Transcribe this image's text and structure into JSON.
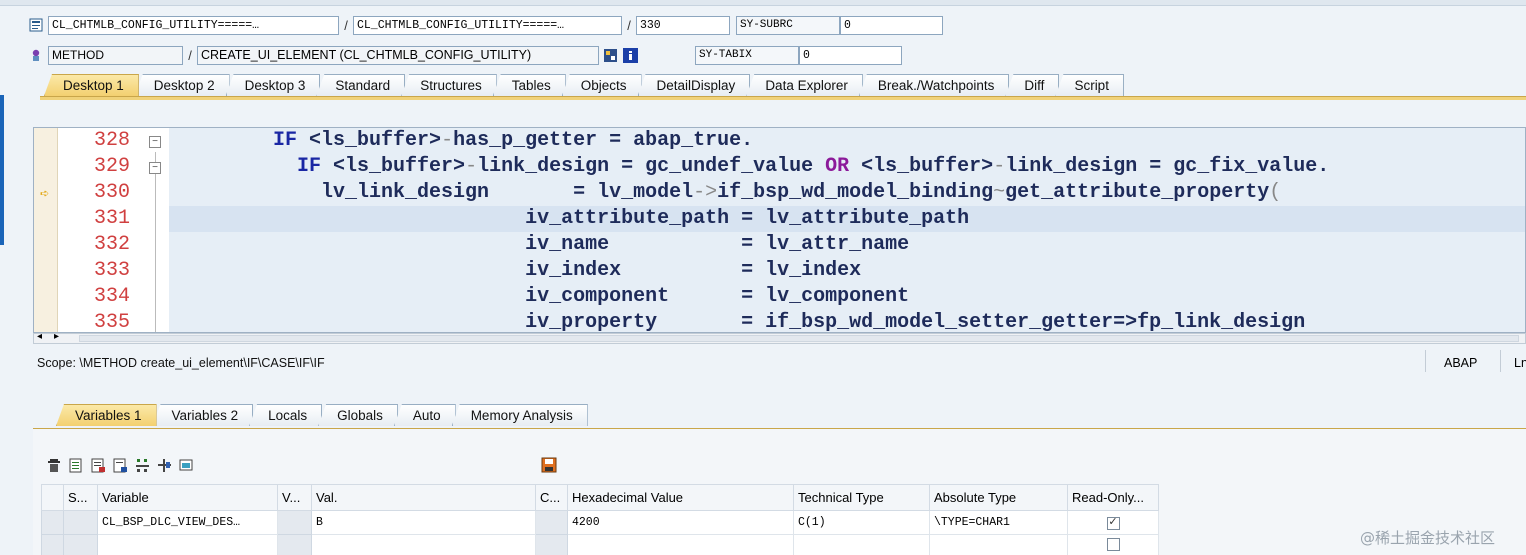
{
  "header": {
    "row1": {
      "field1": "CL_CHTMLB_CONFIG_UTILITY=====…",
      "field2": "CL_CHTMLB_CONFIG_UTILITY=====…",
      "line": "330",
      "sy_label": "SY-SUBRC",
      "sy_value": "0"
    },
    "row2": {
      "kind": "METHOD",
      "name": "CREATE_UI_ELEMENT (CL_CHTMLB_CONFIG_UTILITY)",
      "sy_label": "SY-TABIX",
      "sy_value": "0"
    },
    "separator": "/"
  },
  "main_tabs": [
    "Desktop 1",
    "Desktop 2",
    "Desktop 3",
    "Standard",
    "Structures",
    "Tables",
    "Objects",
    "DetailDisplay",
    "Data Explorer",
    "Break./Watchpoints",
    "Diff",
    "Script"
  ],
  "main_tabs_active": 0,
  "editor": {
    "lines": [
      {
        "num": "328",
        "indent": "      ",
        "parts": [
          [
            "kw",
            "IF "
          ],
          [
            "",
            "<ls_buffer>"
          ],
          [
            "op",
            "-"
          ],
          [
            "",
            "has_p_getter = abap_true."
          ]
        ]
      },
      {
        "num": "329",
        "indent": "        ",
        "parts": [
          [
            "kw",
            "IF "
          ],
          [
            "",
            "<ls_buffer>"
          ],
          [
            "op",
            "-"
          ],
          [
            "",
            "link_design = gc_undef_value "
          ],
          [
            "kw2",
            "OR "
          ],
          [
            "",
            "<ls_buffer>"
          ],
          [
            "op",
            "-"
          ],
          [
            "",
            "link_design = gc_fix_value."
          ]
        ]
      },
      {
        "num": "330",
        "indent": "          ",
        "parts": [
          [
            "",
            "lv_link_design       = lv_model"
          ],
          [
            "op",
            "->"
          ],
          [
            "",
            "if_bsp_wd_model_binding"
          ],
          [
            "op",
            "~"
          ],
          [
            "",
            "get_attribute_property"
          ],
          [
            "op",
            "("
          ]
        ]
      },
      {
        "num": "331",
        "indent": "                           ",
        "parts": [
          [
            "",
            "iv_attribute_path = lv_attribute_path"
          ]
        ]
      },
      {
        "num": "332",
        "indent": "                           ",
        "parts": [
          [
            "",
            "iv_name           = lv_attr_name"
          ]
        ]
      },
      {
        "num": "333",
        "indent": "                           ",
        "parts": [
          [
            "",
            "iv_index          = lv_index"
          ]
        ]
      },
      {
        "num": "334",
        "indent": "                           ",
        "parts": [
          [
            "",
            "iv_component      = lv_component"
          ]
        ]
      },
      {
        "num": "335",
        "indent": "                           ",
        "parts": [
          [
            "",
            "iv_property       = if_bsp_wd_model_setter_getter=>fp_link_design"
          ]
        ]
      }
    ]
  },
  "status": {
    "scope": "Scope: \\METHOD create_ui_element\\IF\\CASE\\IF\\IF",
    "language": "ABAP",
    "extra": "Ln"
  },
  "var_tabs": [
    "Variables 1",
    "Variables 2",
    "Locals",
    "Globals",
    "Auto",
    "Memory Analysis"
  ],
  "var_tabs_active": 0,
  "table": {
    "columns": [
      "S...",
      "Variable",
      "V...",
      "Val.",
      "C...",
      "Hexadecimal Value",
      "Technical Type",
      "Absolute Type",
      "Read-Only..."
    ],
    "rows": [
      {
        "variable": "CL_BSP_DLC_VIEW_DES…",
        "value": "B",
        "hex": "4200",
        "tech": "C(1)",
        "abs": "\\TYPE=CHAR1",
        "readonly": "✓"
      },
      {
        "variable": "",
        "value": "",
        "hex": "",
        "tech": "",
        "abs": "",
        "readonly": ""
      }
    ]
  },
  "watermark": "@稀土掘金技术社区"
}
